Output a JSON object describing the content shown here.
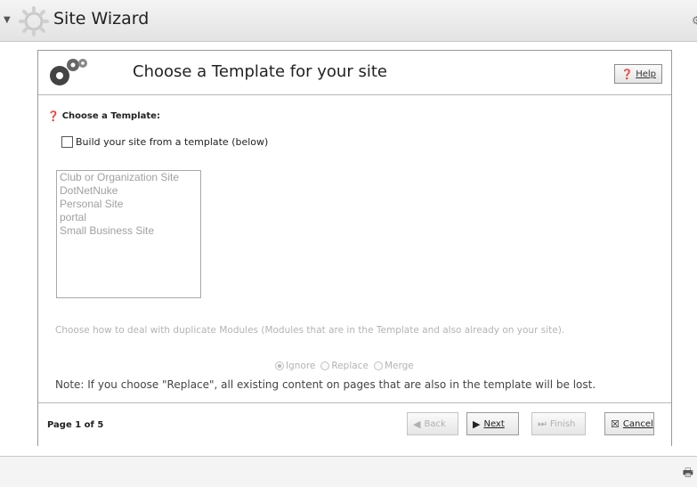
{
  "window": {
    "title": "Site Wizard",
    "icons": {
      "collapse": "triangle-down-icon",
      "app": "gear-icon",
      "print": "printer-icon"
    }
  },
  "dialog": {
    "header_title": "Choose a Template for your site",
    "help_label": "Help",
    "section_label": "Choose a Template:",
    "checkbox_label": "Build your site from a template (below)",
    "checkbox_checked": false,
    "templates": [
      "Club or Organization Site",
      "DotNetNuke",
      "Personal Site",
      "portal",
      "Small Business Site"
    ],
    "duplicate_text": "Choose how to deal with duplicate Modules (Modules that are in the Template and also already on your site).",
    "radio_options": [
      {
        "label": "Ignore",
        "selected": true
      },
      {
        "label": "Replace",
        "selected": false
      },
      {
        "label": "Merge",
        "selected": false
      }
    ],
    "note": "Note: If you choose \"Replace\", all existing content on pages that are also in the template will be lost.",
    "page_indicator": "Page 1 of 5",
    "buttons": {
      "back": "Back",
      "next": "Next",
      "finish": "Finish",
      "cancel": "Cancel"
    }
  }
}
